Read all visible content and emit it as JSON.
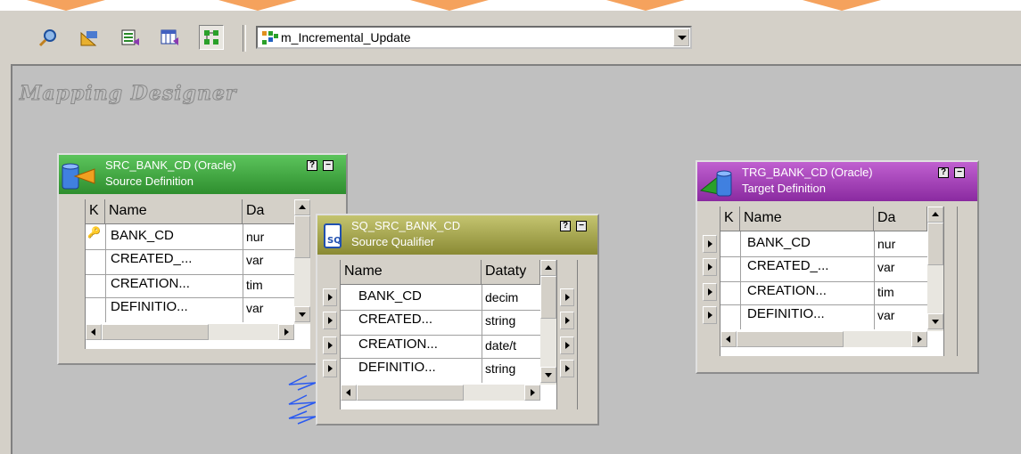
{
  "toolbar": {
    "icons": [
      "source-analyzer-icon",
      "target-designer-icon",
      "transformation-developer-icon",
      "mapplet-designer-icon",
      "mapping-designer-icon"
    ],
    "active_index": 4,
    "mapping_select": {
      "value": "m_Incremental_Update"
    }
  },
  "workspace": {
    "title": "Mapping Designer"
  },
  "source_definition": {
    "title": "SRC_BANK_CD (Oracle)",
    "subtitle": "Source Definition",
    "header_color": "#3faa3f",
    "help_btn": "?",
    "columns": {
      "key": "K",
      "name": "Name",
      "datatype": "Da"
    },
    "rows": [
      {
        "key": "🔑",
        "name": "BANK_CD",
        "datatype": "nur"
      },
      {
        "key": "",
        "name": "CREATED_...",
        "datatype": "var"
      },
      {
        "key": "",
        "name": "CREATION...",
        "datatype": "tim"
      },
      {
        "key": "",
        "name": "DEFINITIO...",
        "datatype": "var"
      }
    ]
  },
  "source_qualifier": {
    "title": "SQ_SRC_BANK_CD",
    "subtitle": "Source Qualifier",
    "header_color": "#a8a848",
    "help_btn": "?",
    "columns": {
      "name": "Name",
      "datatype": "Dataty"
    },
    "rows": [
      {
        "name": "BANK_CD",
        "datatype": "decim"
      },
      {
        "name": "CREATED...",
        "datatype": "string"
      },
      {
        "name": "CREATION...",
        "datatype": "date/t"
      },
      {
        "name": "DEFINITIO...",
        "datatype": "string"
      }
    ]
  },
  "target_definition": {
    "title": "TRG_BANK_CD (Oracle)",
    "subtitle": "Target Definition",
    "header_color": "#a040b0",
    "help_btn": "?",
    "columns": {
      "key": "K",
      "name": "Name",
      "datatype": "Da"
    },
    "rows": [
      {
        "key": "",
        "name": "BANK_CD",
        "datatype": "nur"
      },
      {
        "key": "",
        "name": "CREATED_...",
        "datatype": "var"
      },
      {
        "key": "",
        "name": "CREATION...",
        "datatype": "tim"
      },
      {
        "key": "",
        "name": "DEFINITIO...",
        "datatype": "var"
      }
    ]
  }
}
